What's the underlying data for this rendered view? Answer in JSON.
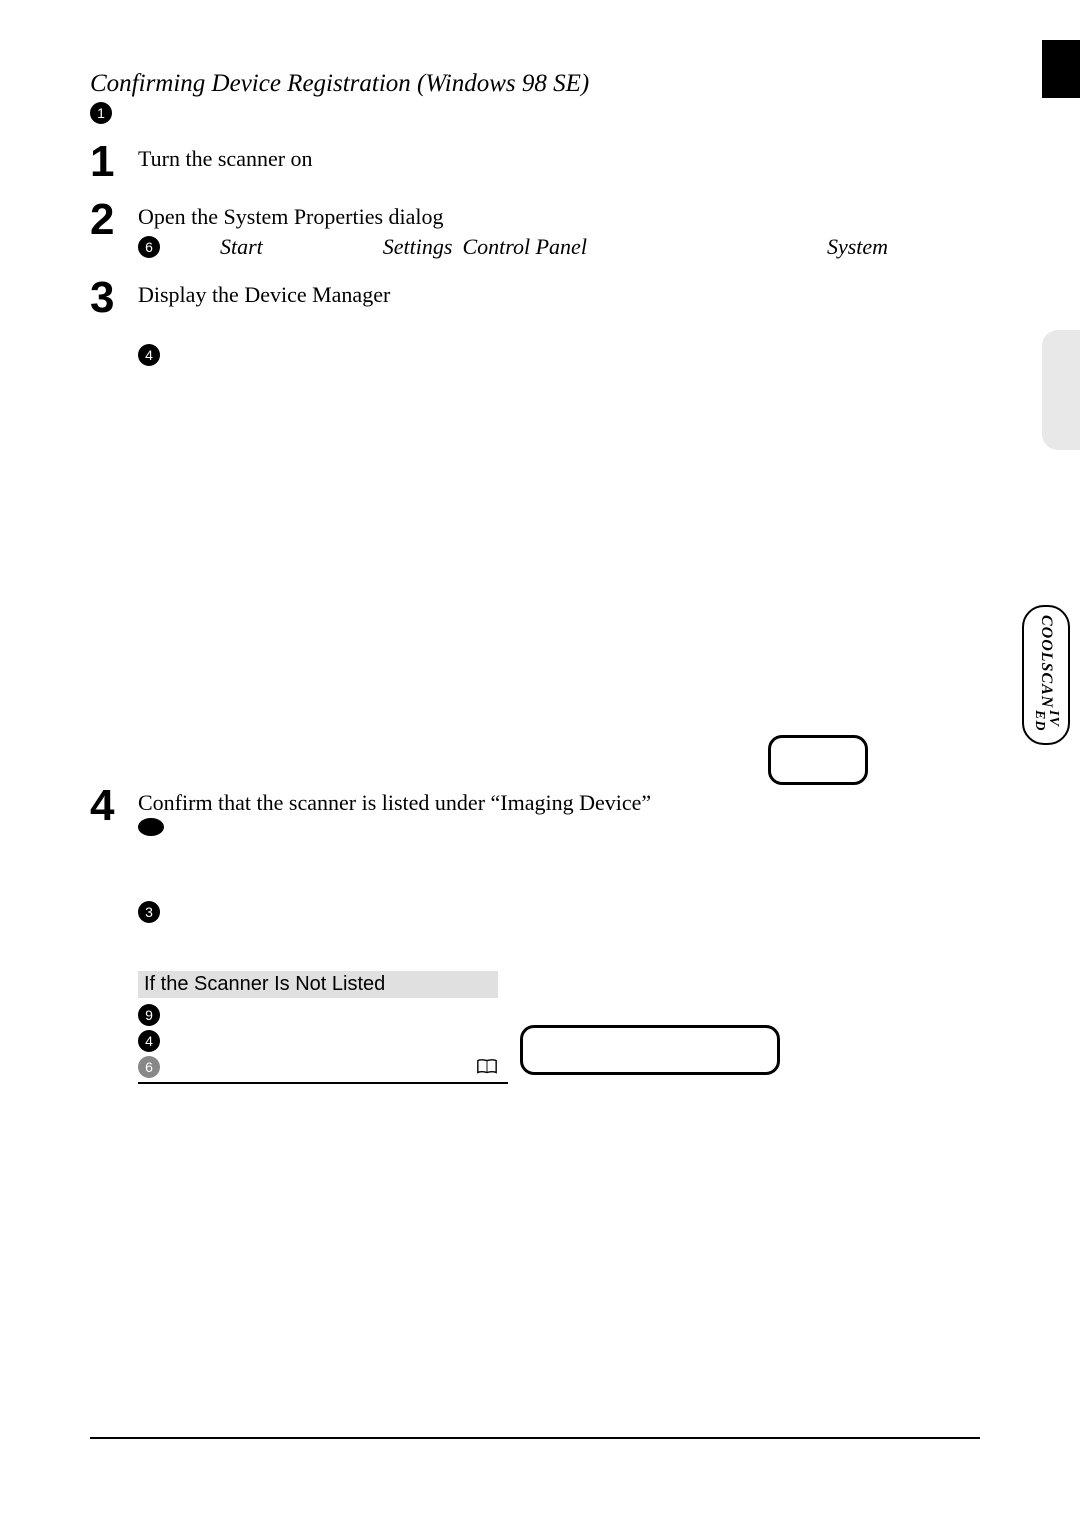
{
  "title": "Confirming Device Registration (Windows 98 SE)",
  "title_marker": "1",
  "steps": [
    {
      "num": "1",
      "heading": "Turn the scanner on"
    },
    {
      "num": "2",
      "heading": "Open the System Properties dialog",
      "nav_marker": "6",
      "nav": [
        "Start",
        "Settings",
        "Control Panel",
        "System"
      ]
    },
    {
      "num": "3",
      "heading": "Display the Device Manager",
      "sub_marker": "4"
    },
    {
      "num": "4",
      "heading": "Confirm that the scanner is listed under “Imaging Device”",
      "sub_marker": "3"
    }
  ],
  "not_listed": {
    "title": "If the Scanner Is Not Listed",
    "markers": [
      "9",
      "4",
      "6"
    ]
  },
  "product_badge": {
    "line1": "COOLSCAN",
    "line2": "IV ED"
  }
}
